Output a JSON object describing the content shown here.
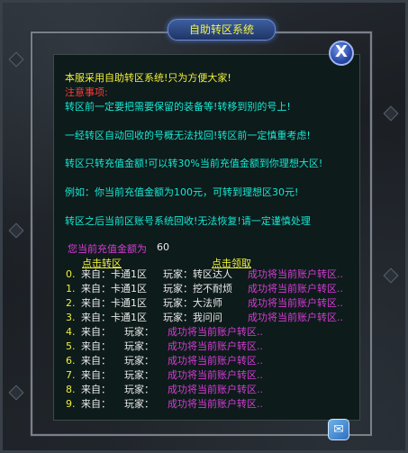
{
  "window": {
    "title": "自助转区系统",
    "close_label": "X"
  },
  "notice": {
    "line1": "本服采用自助转区系统!只为方便大家!",
    "attention": "注意事项:",
    "line2": "转区前一定要把需要保留的装备等!转移到别的号上!",
    "line3": "一经转区自动回收的号概无法找回!转区前一定慎重考虑!",
    "line4": "转区只转充值金额!可以转30%当前充值金额到你理想大区!",
    "line5": "例如：你当前充值金额为100元，可转到理想区30元!",
    "line6": "转区之后当前区账号系统回收!无法恢复!请一定谨慎处理"
  },
  "balance": {
    "label": "您当前充值金额为",
    "value": "60"
  },
  "actions": {
    "transfer_link": "点击转区",
    "claim_link": "点击领取"
  },
  "records": [
    {
      "num": "0.",
      "from": "来自：卡通1区",
      "player": "玩家：转区达人",
      "msg": "成功将当前账户转区.."
    },
    {
      "num": "1.",
      "from": "来自：卡通1区",
      "player": "玩家：挖不耐烦",
      "msg": "成功将当前账户转区.."
    },
    {
      "num": "2.",
      "from": "来自：卡通1区",
      "player": "玩家：大法师",
      "msg": "成功将当前账户转区.."
    },
    {
      "num": "3.",
      "from": "来自：卡通1区",
      "player": "玩家：我问问",
      "msg": "成功将当前账户转区.."
    },
    {
      "num": "4.",
      "from": "来自：",
      "player": "玩家：",
      "msg": "成功将当前账户转区.."
    },
    {
      "num": "5.",
      "from": "来自：",
      "player": "玩家：",
      "msg": "成功将当前账户转区.."
    },
    {
      "num": "6.",
      "from": "来自：",
      "player": "玩家：",
      "msg": "成功将当前账户转区.."
    },
    {
      "num": "7.",
      "from": "来自：",
      "player": "玩家：",
      "msg": "成功将当前账户转区.."
    },
    {
      "num": "8.",
      "from": "来自：",
      "player": "玩家：",
      "msg": "成功将当前账户转区.."
    },
    {
      "num": "9.",
      "from": "来自：",
      "player": "玩家：",
      "msg": "成功将当前账户转区.."
    }
  ],
  "colors": {
    "title_text": "#f2f24a",
    "notice_text": "#16e8d4",
    "attention_text": "#ff3c3c",
    "record_message": "#d63cd6",
    "balance_label": "#d63cd6"
  },
  "icons": {
    "close": "close-icon",
    "corner": "mail-icon"
  }
}
